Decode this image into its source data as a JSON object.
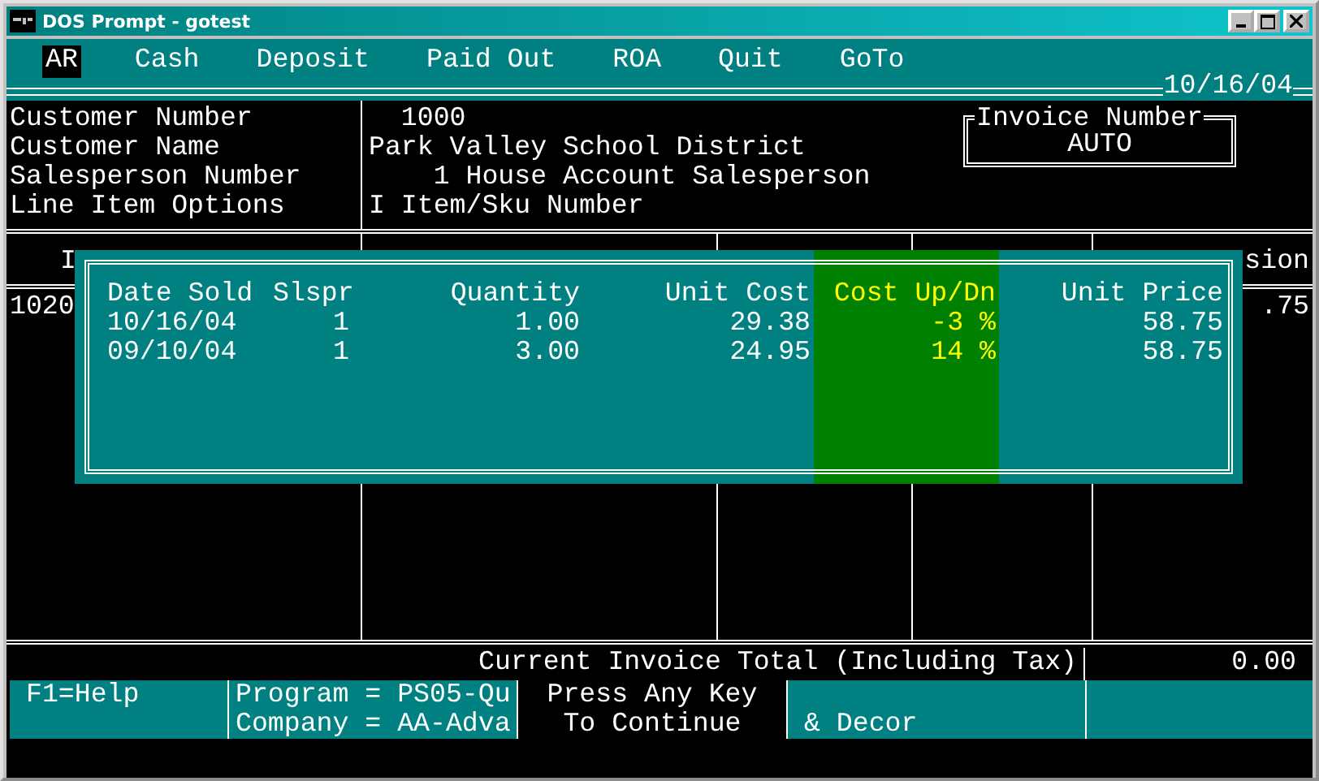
{
  "window": {
    "title": "DOS Prompt - gotest"
  },
  "menu": [
    {
      "label": "AR",
      "selected": true
    },
    {
      "label": "Cash",
      "selected": false
    },
    {
      "label": "Deposit",
      "selected": false
    },
    {
      "label": "Paid Out",
      "selected": false
    },
    {
      "label": "ROA",
      "selected": false
    },
    {
      "label": "Quit",
      "selected": false
    },
    {
      "label": "GoTo",
      "selected": false
    }
  ],
  "date": "10/16/04",
  "fields": [
    {
      "label": "Customer Number",
      "value": "1000"
    },
    {
      "label": "Customer Name",
      "value": "Park Valley School District"
    },
    {
      "label": "Salesperson Number",
      "value": "1 House Account Salesperson"
    },
    {
      "label": "Line Item Options",
      "value": "I Item/Sku Number"
    }
  ],
  "invoice": {
    "label": "Invoice Number",
    "value": "AUTO"
  },
  "table": {
    "header_first": "I",
    "header_last": "sion",
    "row_first": "1020",
    "row_last": ".75"
  },
  "popup": {
    "columns": [
      {
        "label": "Date Sold",
        "highlighted": false
      },
      {
        "label": "Slspr",
        "highlighted": false
      },
      {
        "label": "Quantity",
        "highlighted": false
      },
      {
        "label": "Unit Cost",
        "highlighted": false
      },
      {
        "label": "Cost Up/Dn",
        "highlighted": true
      },
      {
        "label": "Unit Price",
        "highlighted": false
      }
    ],
    "rows": [
      [
        "10/16/04",
        "1",
        "1.00",
        "29.38",
        "-3 %",
        "58.75"
      ],
      [
        "09/10/04",
        "1",
        "3.00",
        "24.95",
        "14 %",
        "58.75"
      ]
    ]
  },
  "total": {
    "label": "Current Invoice Total (Including Tax)",
    "value": "0.00"
  },
  "status_bar": [
    {
      "lines": [
        "F1=Help"
      ],
      "inverse": false
    },
    {
      "lines": [
        "Program = PS05-Qu",
        "Company = AA-Adva"
      ],
      "inverse": false
    },
    {
      "lines": [
        "Press Any Key",
        "To Continue"
      ],
      "inverse": true
    },
    {
      "lines": [
        "& Decor"
      ],
      "inverse": false
    }
  ]
}
